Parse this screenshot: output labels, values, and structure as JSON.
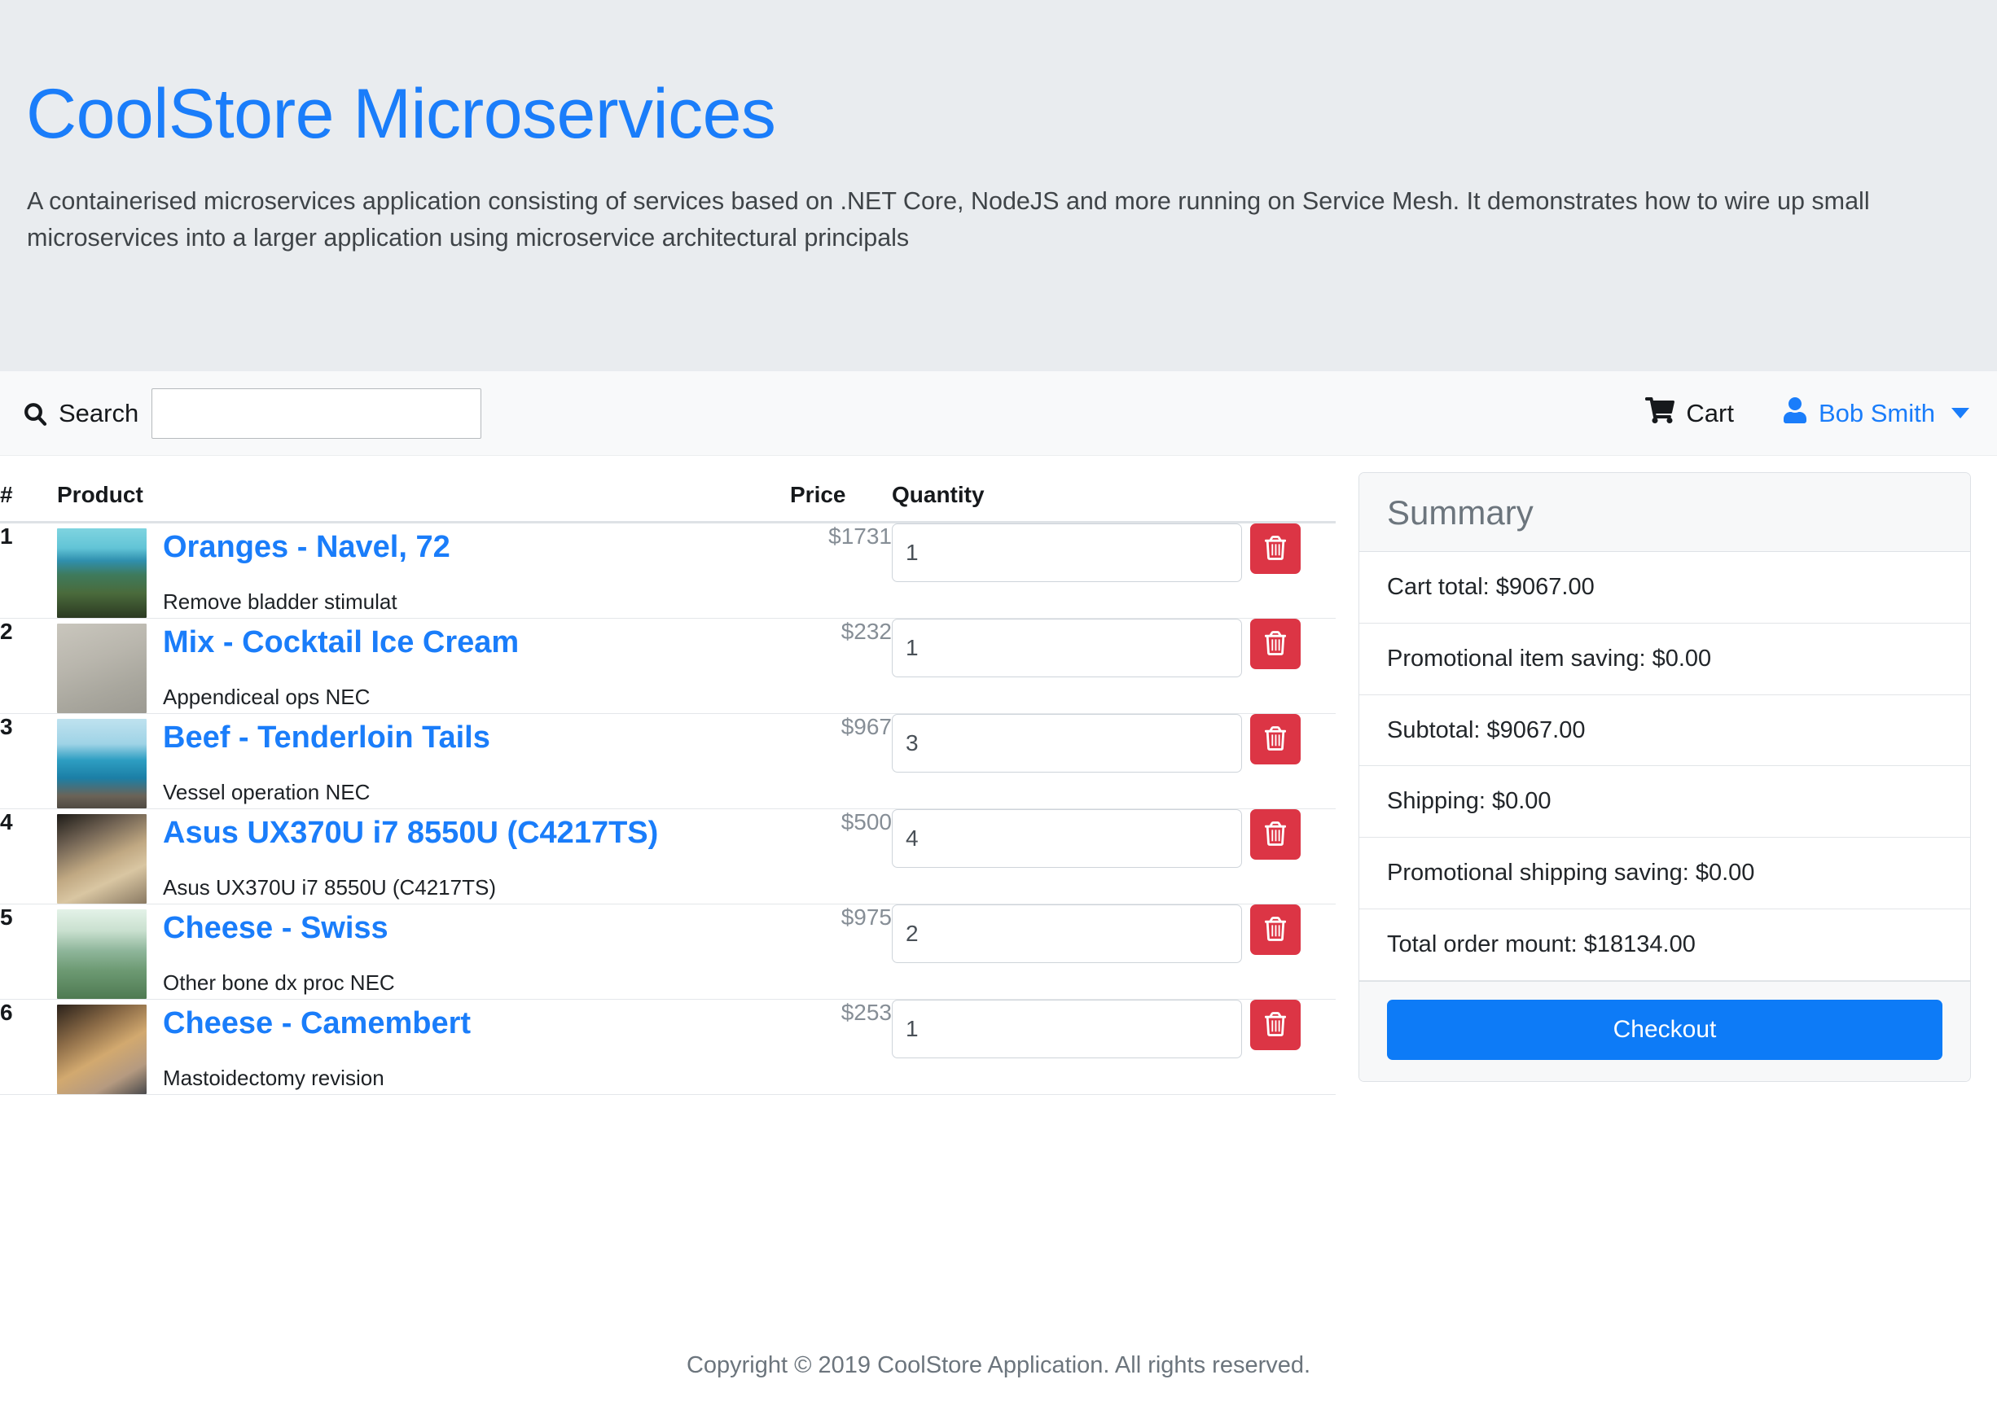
{
  "hero": {
    "title": "CoolStore Microservices",
    "subtitle": "A containerised microservices application consisting of services based on .NET Core, NodeJS and more running on Service Mesh. It demonstrates how to wire up small microservices into a larger application using microservice architectural principals"
  },
  "navbar": {
    "search_label": "Search",
    "search_value": "",
    "search_placeholder": "",
    "cart_label": "Cart",
    "user_label": "Bob Smith"
  },
  "cart": {
    "headers": {
      "index": "#",
      "product": "Product",
      "price": "Price",
      "quantity": "Quantity",
      "actions": ""
    },
    "rows": [
      {
        "index": "1",
        "name": "Oranges - Navel, 72",
        "desc": "Remove bladder stimulat",
        "price": "$1731",
        "quantity": "1",
        "thumb_gradient": "linear-gradient(180deg,#7fd4e0 0%,#62c4d6 22%,#2f8fae 36%,#3e7a5c 52%,#4a6b3c 72%,#2c3a22 100%)"
      },
      {
        "index": "2",
        "name": "Mix - Cocktail Ice Cream",
        "desc": "Appendiceal ops NEC",
        "price": "$232",
        "quantity": "1",
        "thumb_gradient": "linear-gradient(160deg,#c9c6bd 0%,#b9b6ad 40%,#a9a79e 70%,#9c9a92 100%)"
      },
      {
        "index": "3",
        "name": "Beef - Tenderloin Tails",
        "desc": "Vessel operation NEC",
        "price": "$967",
        "quantity": "3",
        "thumb_gradient": "linear-gradient(180deg,#bfe2ef 0%,#9fd3e6 28%,#2e9ec2 46%,#1b7fa6 66%,#6b6357 86%,#4f4a42 100%)"
      },
      {
        "index": "4",
        "name": "Asus UX370U i7 8550U (C4217TS)",
        "desc": "Asus UX370U i7 8550U (C4217TS)",
        "price": "$500",
        "quantity": "4",
        "thumb_gradient": "linear-gradient(155deg,#1d1b17 0%,#6f6152 26%,#c0a882 52%,#d9c6a2 70%,#8a7a63 100%)"
      },
      {
        "index": "5",
        "name": "Cheese - Swiss",
        "desc": "Other bone dx proc NEC",
        "price": "$975",
        "quantity": "2",
        "thumb_gradient": "linear-gradient(180deg,#e4f2e8 0%,#c9e0cf 24%,#8fb69b 46%,#6d9a73 68%,#4f7a52 100%)"
      },
      {
        "index": "6",
        "name": "Cheese - Camembert",
        "desc": "Mastoidectomy revision",
        "price": "$253",
        "quantity": "1",
        "thumb_gradient": "linear-gradient(150deg,#2a211a 0%,#8a6a46 30%,#d2a96f 55%,#b59a80 78%,#4a4a4c 100%)"
      }
    ]
  },
  "summary": {
    "title": "Summary",
    "items": [
      "Cart total: $9067.00",
      "Promotional item saving: $0.00",
      "Subtotal: $9067.00",
      "Shipping: $0.00",
      "Promotional shipping saving: $0.00",
      "Total order mount: $18134.00"
    ],
    "checkout_label": "Checkout"
  },
  "footer": {
    "copyright": "Copyright © 2019 CoolStore Application. All rights reserved."
  },
  "colors": {
    "accent_blue": "#1a7dfa",
    "checkout_blue": "#0d7bf7",
    "danger_red": "#dc3545",
    "hero_bg": "#e9ecef",
    "navbar_bg": "#f8f9fa",
    "muted_text": "#6c757d"
  }
}
